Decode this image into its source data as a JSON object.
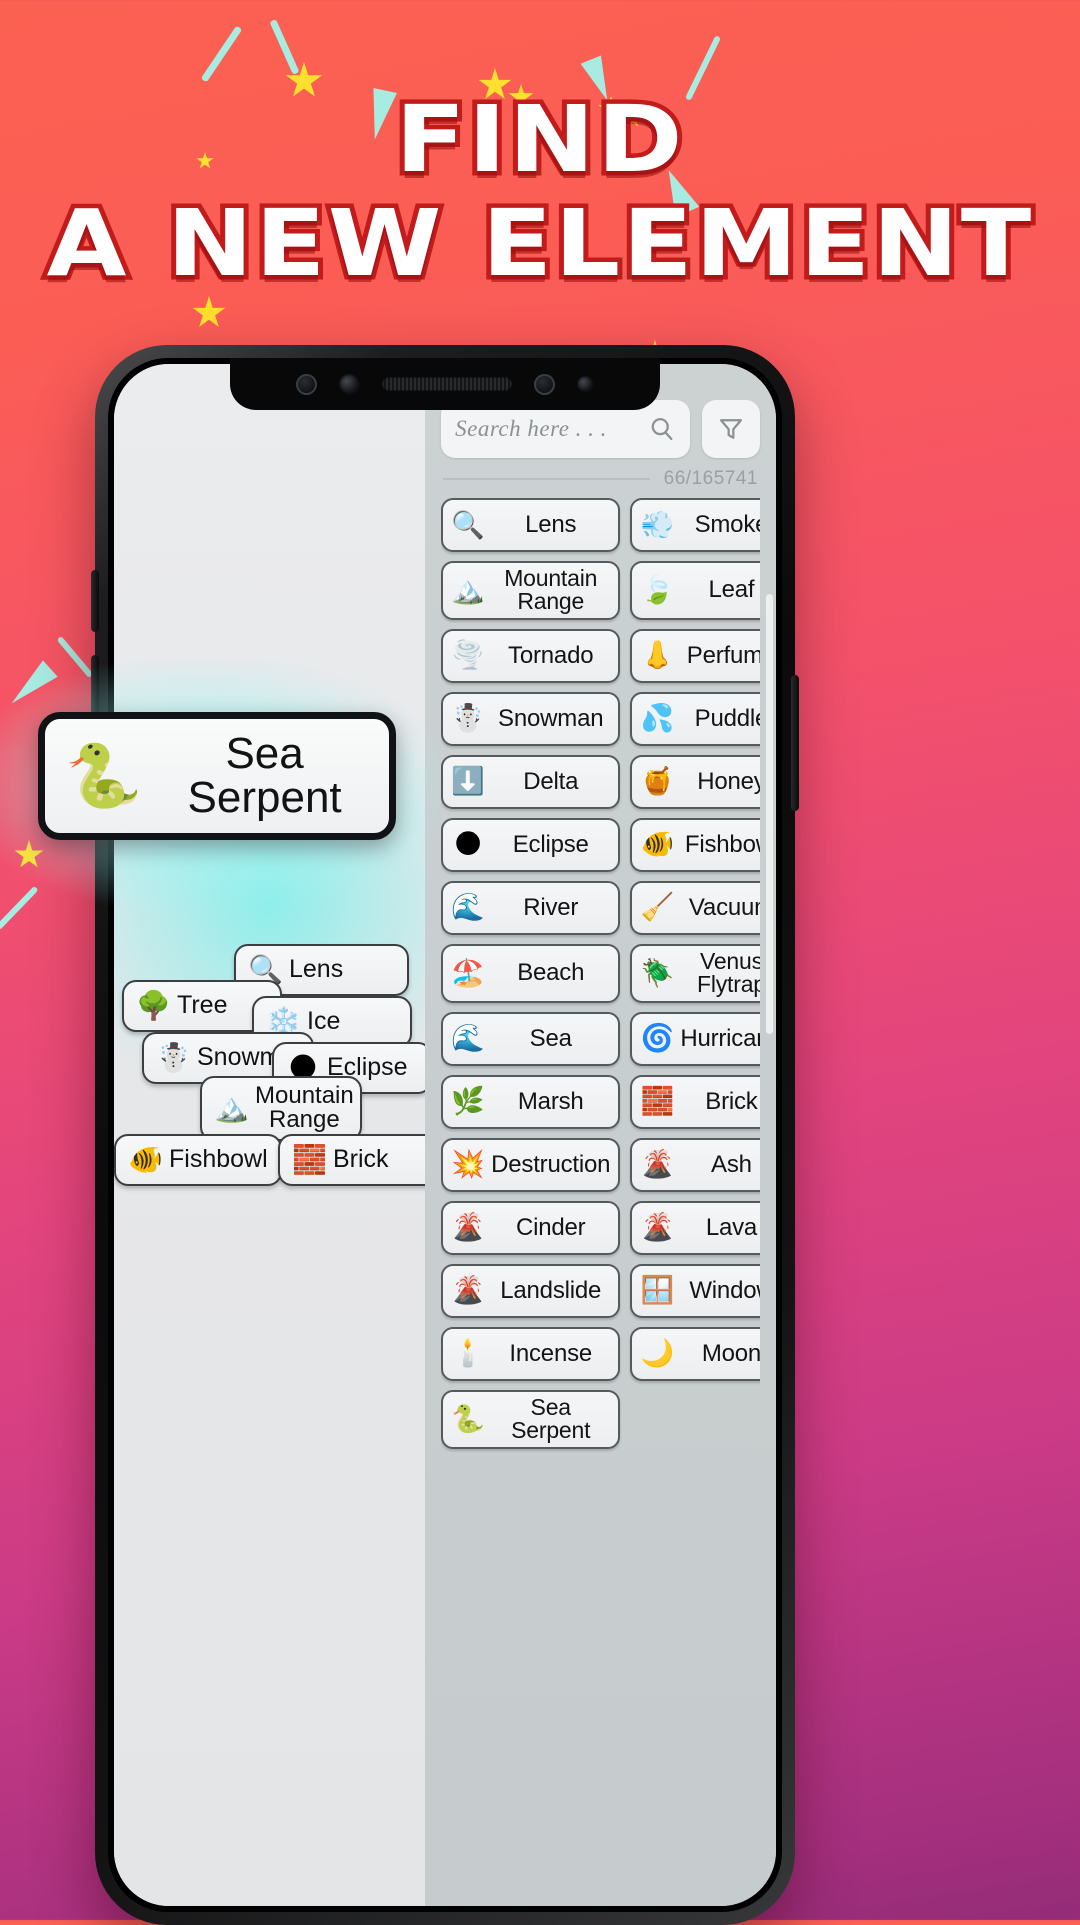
{
  "headline": {
    "line1": "FIND",
    "line2": "A NEW ELEMENT"
  },
  "colors": {
    "background_top": "#fb6151",
    "background_bottom": "#942c78",
    "headline_fill": "#ffffff",
    "headline_stroke": "#c21b1b",
    "confetti_star": "#ffe02e",
    "confetti_shard": "#a8ebe0",
    "glow": "#7eefeb",
    "chip_border": "#555a5d",
    "panel_bg": "#c9cfd0",
    "workspace_bg": "#e7e8ea"
  },
  "app": {
    "search": {
      "placeholder": "Search here . . .",
      "value": "",
      "search_icon": "search-icon",
      "filter_icon": "filter-icon"
    },
    "counter": "66/165741",
    "elements": [
      {
        "emoji": "🔍",
        "label": "Lens"
      },
      {
        "emoji": "💨",
        "label": "Smoke"
      },
      {
        "emoji": "🏔️",
        "label": "Mountain Range"
      },
      {
        "emoji": "🍃",
        "label": "Leaf"
      },
      {
        "emoji": "🌪️",
        "label": "Tornado"
      },
      {
        "emoji": "👃",
        "label": "Perfume"
      },
      {
        "emoji": "☃️",
        "label": "Snowman"
      },
      {
        "emoji": "💦",
        "label": "Puddle"
      },
      {
        "emoji": "⬇️",
        "label": "Delta"
      },
      {
        "emoji": "🍯",
        "label": "Honey"
      },
      {
        "emoji": "🌑",
        "label": "Eclipse"
      },
      {
        "emoji": "🐠",
        "label": "Fishbowl"
      },
      {
        "emoji": "🌊",
        "label": "River"
      },
      {
        "emoji": "🧹",
        "label": "Vacuum"
      },
      {
        "emoji": "🏖️",
        "label": "Beach"
      },
      {
        "emoji": "🪲",
        "label": "Venus Flytrap"
      },
      {
        "emoji": "🌊",
        "label": "Sea"
      },
      {
        "emoji": "🌀",
        "label": "Hurricane"
      },
      {
        "emoji": "🌿",
        "label": "Marsh"
      },
      {
        "emoji": "🧱",
        "label": "Brick"
      },
      {
        "emoji": "💥",
        "label": "Destruction"
      },
      {
        "emoji": "🌋",
        "label": "Ash"
      },
      {
        "emoji": "🌋",
        "label": "Cinder"
      },
      {
        "emoji": "🌋",
        "label": "Lava"
      },
      {
        "emoji": "🌋",
        "label": "Landslide"
      },
      {
        "emoji": "🪟",
        "label": "Window"
      },
      {
        "emoji": "🕯️",
        "label": "Incense"
      },
      {
        "emoji": "🌙",
        "label": "Moon"
      },
      {
        "emoji": "🐍",
        "label": "Sea Serpent"
      }
    ],
    "workspace_chips": [
      {
        "emoji": "🔍",
        "label": "Lens"
      },
      {
        "emoji": "🌳",
        "label": "Tree"
      },
      {
        "emoji": "❄️",
        "label": "Ice"
      },
      {
        "emoji": "☃️",
        "label": "Snowman"
      },
      {
        "emoji": "🌑",
        "label": "Eclipse"
      },
      {
        "emoji": "🏔️",
        "label": "Mountain Range"
      },
      {
        "emoji": "🐠",
        "label": "Fishbowl"
      },
      {
        "emoji": "🧱",
        "label": "Brick"
      }
    ],
    "featured": {
      "emoji": "🐍",
      "label": "Sea Serpent"
    }
  }
}
